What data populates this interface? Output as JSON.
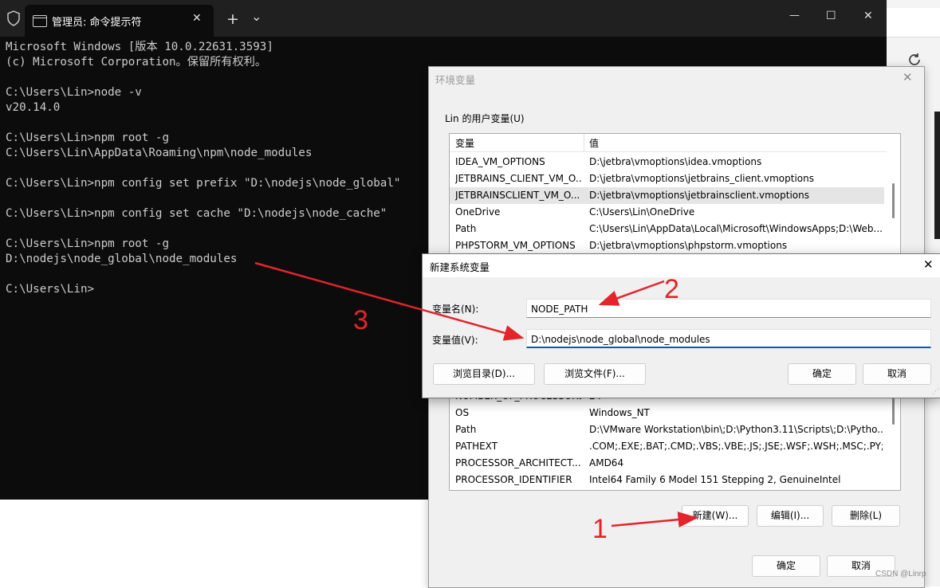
{
  "terminal": {
    "tab_title": "管理员: 命令提示符",
    "controls": {
      "new_tab": "+",
      "dropdown": "⌄",
      "minimize": "—",
      "maximize": "☐",
      "close": "✕",
      "tab_close": "✕"
    },
    "output": "Microsoft Windows [版本 10.0.22631.3593]\n(c) Microsoft Corporation。保留所有权利。\n\nC:\\Users\\Lin>node -v\nv20.14.0\n\nC:\\Users\\Lin>npm root -g\nC:\\Users\\Lin\\AppData\\Roaming\\npm\\node_modules\n\nC:\\Users\\Lin>npm config set prefix \"D:\\nodejs\\node_global\"\n\nC:\\Users\\Lin>npm config set cache \"D:\\nodejs\\node_cache\"\n\nC:\\Users\\Lin>npm root -g\nD:\\nodejs\\node_global\\node_modules\n\nC:\\Users\\Lin>"
  },
  "env_dialog": {
    "title": "环境变量",
    "close": "✕",
    "user_group_label": "Lin 的用户变量(U)",
    "columns": {
      "variable": "变量",
      "value": "值"
    },
    "user_rows": [
      {
        "name": "IDEA_VM_OPTIONS",
        "value": "D:\\jetbra\\vmoptions\\idea.vmoptions"
      },
      {
        "name": "JETBRAINS_CLIENT_VM_O...",
        "value": "D:\\jetbra\\vmoptions\\jetbrains_client.vmoptions"
      },
      {
        "name": "JETBRAINSCLIENT_VM_O...",
        "value": "D:\\jetbra\\vmoptions\\jetbrainsclient.vmoptions"
      },
      {
        "name": "OneDrive",
        "value": "C:\\Users\\Lin\\OneDrive"
      },
      {
        "name": "Path",
        "value": "C:\\Users\\Lin\\AppData\\Local\\Microsoft\\WindowsApps;D:\\Web..."
      },
      {
        "name": "PHPSTORM_VM_OPTIONS",
        "value": "D:\\jetbra\\vmoptions\\phpstorm.vmoptions"
      }
    ],
    "system_rows": [
      {
        "name": "NUMBER_OF_PROCESSORS",
        "value": "24"
      },
      {
        "name": "OS",
        "value": "Windows_NT"
      },
      {
        "name": "Path",
        "value": "D:\\VMware Workstation\\bin\\;D:\\Python3.11\\Scripts\\;D:\\Pytho..."
      },
      {
        "name": "PATHEXT",
        "value": ".COM;.EXE;.BAT;.CMD;.VBS;.VBE;.JS;.JSE;.WSF;.WSH;.MSC;.PY;.P..."
      },
      {
        "name": "PROCESSOR_ARCHITECT...",
        "value": "AMD64"
      },
      {
        "name": "PROCESSOR_IDENTIFIER",
        "value": "Intel64 Family 6 Model 151 Stepping 2, GenuineIntel"
      }
    ],
    "buttons": {
      "new": "新建(W)...",
      "edit": "编辑(I)...",
      "delete": "删除(L)",
      "ok": "确定",
      "cancel": "取消"
    }
  },
  "new_var_dialog": {
    "title": "新建系统变量",
    "close": "✕",
    "name_label": "变量名(N):",
    "name_value": "NODE_PATH",
    "value_label": "变量值(V):",
    "value_value": "D:\\nodejs\\node_global\\node_modules",
    "buttons": {
      "browse_dir": "浏览目录(D)...",
      "browse_file": "浏览文件(F)...",
      "ok": "确定",
      "cancel": "取消"
    }
  },
  "annotations": {
    "step1": "1",
    "step2": "2",
    "step3": "3",
    "color": "#e3242b"
  },
  "watermark": "CSDN @Linrp"
}
